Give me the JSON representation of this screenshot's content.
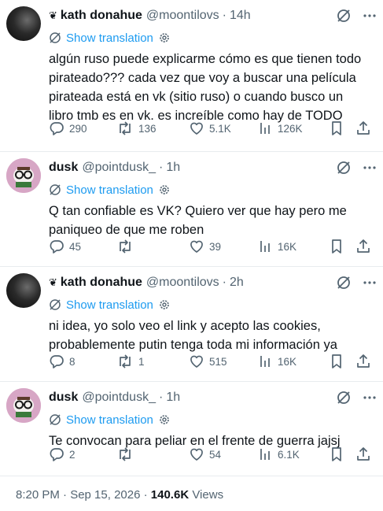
{
  "show_translation": "Show translation",
  "tweets": [
    {
      "author": "kath donahue",
      "handle": "@moontilovs",
      "time": "14h",
      "text_lines": [
        "algún ruso puede explicarme cómo es que tienen todo",
        "pirateado??? cada vez que voy a buscar una película",
        "pirateada está en vk (sitio ruso) o cuando busco un",
        "libro tmb es en vk. es increíble como hay de TODO"
      ],
      "replies": "290",
      "reposts": "136",
      "likes": "5.1K",
      "views": "126K"
    },
    {
      "author": "dusk",
      "handle": "@pointdusk_",
      "time": "1h",
      "text_lines": [
        "Q tan confiable es VK? Quiero ver que hay pero me",
        "paniqueo de que me roben"
      ],
      "replies": "45",
      "reposts": "",
      "likes": "39",
      "views": "16K"
    },
    {
      "author": "kath donahue",
      "handle": "@moontilovs",
      "time": "2h",
      "text_lines": [
        "ni idea, yo solo veo el link y acepto las cookies,",
        "probablemente putin tenga toda mi información ya"
      ],
      "replies": "8",
      "reposts": "1",
      "likes": "515",
      "views": "16K"
    },
    {
      "author": "dusk",
      "handle": "@pointdusk_",
      "time": "1h",
      "text_lines": [
        "Te convocan para peliar en el frente de guerra jajsj"
      ],
      "replies": "2",
      "reposts": "",
      "likes": "54",
      "views": "6.1K"
    }
  ],
  "footer": {
    "time": "8:20 PM · Sep 15, 2026 · ",
    "views_count": "140.6K",
    "views_label": " Views"
  }
}
